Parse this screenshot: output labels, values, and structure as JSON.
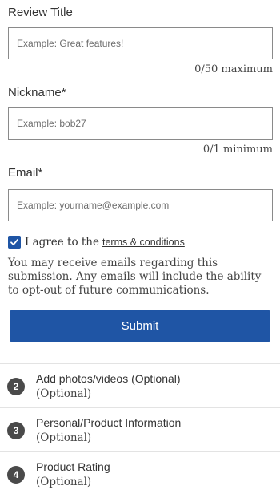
{
  "review_title": {
    "label": "Review Title",
    "placeholder": "Example: Great features!",
    "counter": "0/50 maximum"
  },
  "nickname": {
    "label": "Nickname*",
    "placeholder": "Example: bob27",
    "counter": "0/1 minimum"
  },
  "email": {
    "label": "Email*",
    "placeholder": "Example: yourname@example.com"
  },
  "agree": {
    "checked": true,
    "text": "I agree to the",
    "link": "terms & conditions"
  },
  "disclaimer": "You may receive emails regarding this submission. Any emails will include the ability to opt-out of future communications.",
  "submit_label": "Submit",
  "steps": [
    {
      "number": "2",
      "title": "Add photos/videos (Optional)",
      "subtitle": "(Optional)"
    },
    {
      "number": "3",
      "title": "Personal/Product Information",
      "subtitle": "(Optional)"
    },
    {
      "number": "4",
      "title": "Product Rating",
      "subtitle": "(Optional)"
    }
  ],
  "colors": {
    "accent": "#1f55a5",
    "step_badge": "#4a4a4a"
  },
  "icons": {
    "checkbox": "checkmark-icon"
  }
}
